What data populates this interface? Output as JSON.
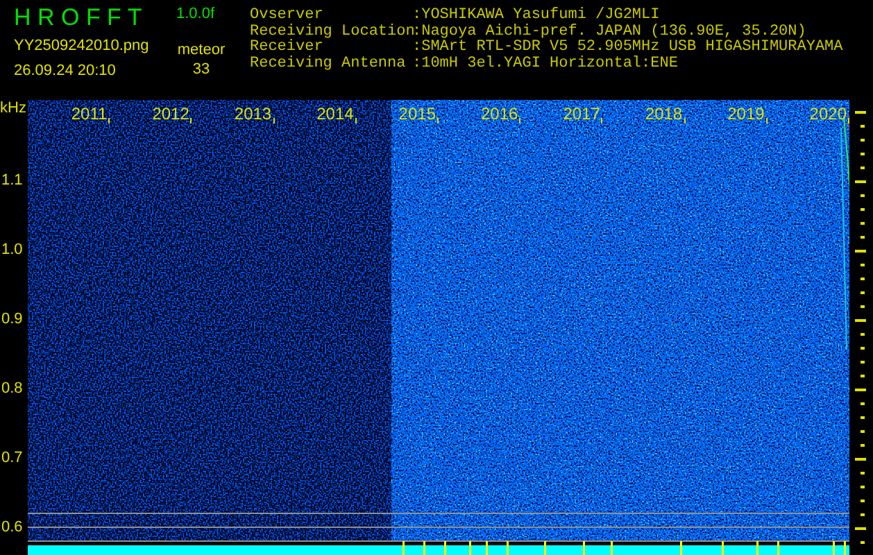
{
  "app": {
    "title": "H R O F F T",
    "version": "1.0.0f"
  },
  "file": {
    "name": "YY2509242010.png",
    "timestamp": "26.09.24 20:10"
  },
  "count": {
    "label": "meteor",
    "value": "33"
  },
  "station_info": [
    {
      "label": "Ovserver",
      "value": ":YOSHIKAWA Yasufumi /JG2MLI"
    },
    {
      "label": "Receiving Location",
      "value": ":Nagoya Aichi-pref. JAPAN (136.90E, 35.20N)"
    },
    {
      "label": "Receiver",
      "value": ":SMArt RTL-SDR V5 52.905MHz USB HIGASHIMURAYAMA"
    },
    {
      "label": "Receiving Antenna",
      "value": ":10mH 3el.YAGI Horizontal:ENE"
    }
  ],
  "spectrogram": {
    "unit": "kHz",
    "y_labels": [
      "1.1",
      "1.0",
      "0.9",
      "0.8",
      "0.7",
      "0.6"
    ],
    "x_labels": [
      "2011",
      "2012",
      "2013",
      "2014",
      "2015",
      "2016",
      "2017",
      "2018",
      "2019",
      "2020"
    ]
  }
}
